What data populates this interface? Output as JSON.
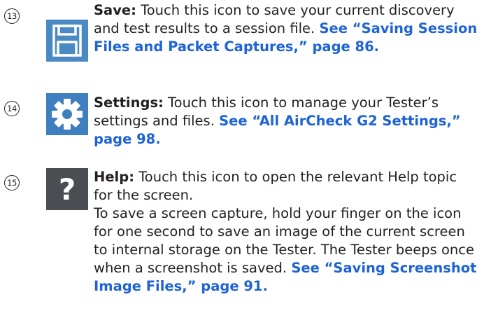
{
  "entries": [
    {
      "number": "13",
      "icon": "save-icon",
      "term": "Save:",
      "description": " Touch this icon to save your current discovery and test results to a session file. ",
      "link": "See “Saving Session Files and Packet Captures,” page 86."
    },
    {
      "number": "14",
      "icon": "gear-icon",
      "term": "Settings:",
      "description": " Touch this icon to manage your Tester’s settings and files. ",
      "link": "See “All AirCheck G2 Settings,” page 98."
    },
    {
      "number": "15",
      "icon": "help-icon",
      "term": "Help:",
      "description": " Touch this icon to open the relevant Help topic for the screen.",
      "extra": "To save a screen capture, hold your finger on the icon for one second to save an image of the current screen to internal storage on the Tester. The Tester beeps once when a screenshot is saved. ",
      "link": "See “Saving Screenshot Image Files,” page 91."
    }
  ],
  "colors": {
    "text": "#231f20",
    "link": "#1e63d6",
    "save_icon_bg": "#4a89c3",
    "settings_icon_bg": "#3f7fbf",
    "help_icon_bg": "#4a4d52"
  }
}
